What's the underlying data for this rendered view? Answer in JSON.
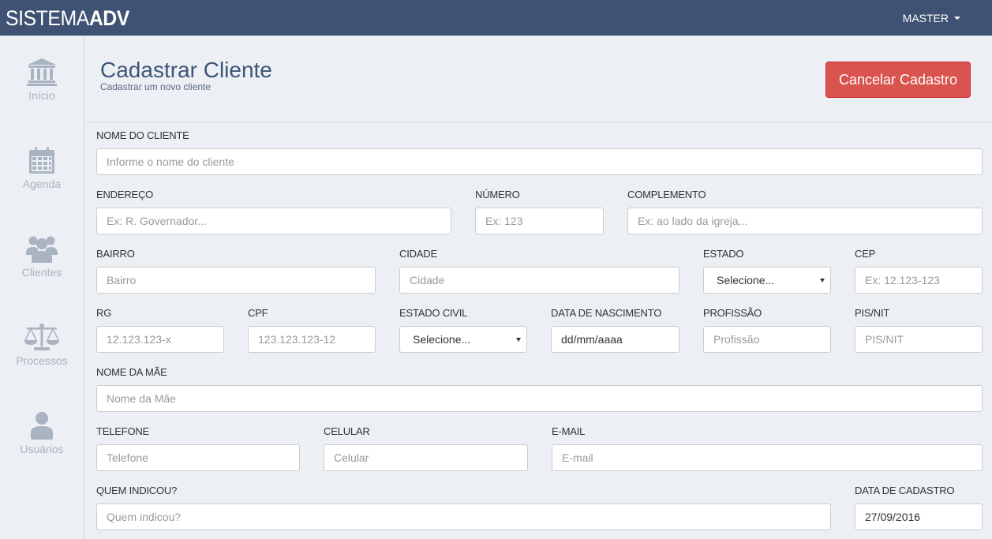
{
  "brand": {
    "light": "SISTEMA",
    "bold": "ADV"
  },
  "user_menu": {
    "label": "MASTER"
  },
  "sidebar": {
    "items": [
      {
        "label": "Início",
        "icon": "bank-icon"
      },
      {
        "label": "Agenda",
        "icon": "calendar-icon"
      },
      {
        "label": "Clientes",
        "icon": "users-icon"
      },
      {
        "label": "Processos",
        "icon": "balance-scale-icon"
      },
      {
        "label": "Usuários",
        "icon": "user-icon"
      }
    ]
  },
  "header": {
    "title": "Cadastrar Cliente",
    "subtitle": "Cadastrar um novo cliente",
    "cancel_label": "Cancelar Cadastro"
  },
  "form": {
    "nome_cliente": {
      "label": "NOME DO CLIENTE",
      "placeholder": "Informe o nome do cliente"
    },
    "endereco": {
      "label": "ENDEREÇO",
      "placeholder": "Ex: R. Governador..."
    },
    "numero": {
      "label": "NÚMERO",
      "placeholder": "Ex: 123"
    },
    "complemento": {
      "label": "COMPLEMENTO",
      "placeholder": "Ex: ao lado da igreja..."
    },
    "bairro": {
      "label": "BAIRRO",
      "placeholder": "Bairro"
    },
    "cidade": {
      "label": "CIDADE",
      "placeholder": "Cidade"
    },
    "estado": {
      "label": "ESTADO",
      "value": "Selecione..."
    },
    "cep": {
      "label": "CEP",
      "placeholder": "Ex: 12.123-123"
    },
    "rg": {
      "label": "RG",
      "placeholder": "12.123.123-x"
    },
    "cpf": {
      "label": "CPF",
      "placeholder": "123.123.123-12"
    },
    "estado_civil": {
      "label": "ESTADO CIVIL",
      "value": "Selecione..."
    },
    "data_nascimento": {
      "label": "DATA DE NASCIMENTO",
      "value": "dd/mm/aaaa"
    },
    "profissao": {
      "label": "PROFISSÃO",
      "placeholder": "Profissão"
    },
    "pis_nit": {
      "label": "PIS/NIT",
      "placeholder": "PIS/NIT"
    },
    "nome_mae": {
      "label": "NOME DA MÃE",
      "placeholder": "Nome da Mãe"
    },
    "telefone": {
      "label": "TELEFONE",
      "placeholder": "Telefone"
    },
    "celular": {
      "label": "CELULAR",
      "placeholder": "Celular"
    },
    "email": {
      "label": "E-MAIL",
      "placeholder": "E-mail"
    },
    "quem_indicou": {
      "label": "QUEM INDICOU?",
      "placeholder": "Quem indicou?"
    },
    "data_cadastro": {
      "label": "DATA DE CADASTRO",
      "value": "27/09/2016"
    }
  },
  "colors": {
    "topbar": "#3f5273",
    "background": "#eceff4",
    "title": "#3e5577",
    "danger": "#d9534f",
    "sidebar_icon": "#a9b3c1"
  }
}
